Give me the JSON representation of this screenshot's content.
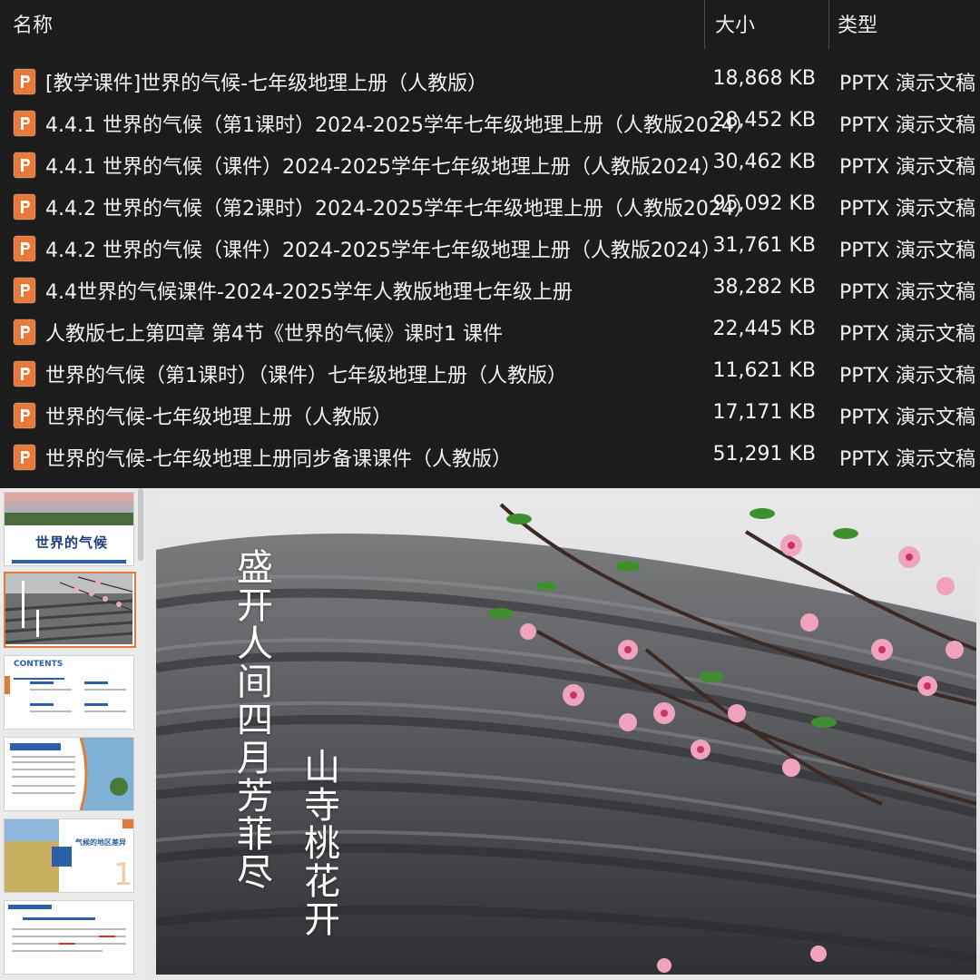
{
  "explorer": {
    "columns": {
      "name": "名称",
      "size": "大小",
      "type": "类型"
    },
    "files": [
      {
        "name": "[教学课件]世界的气候-七年级地理上册（人教版）",
        "size": "18,868 KB",
        "type": "PPTX 演示文稿"
      },
      {
        "name": "4.4.1 世界的气候（第1课时）2024-2025学年七年级地理上册（人教版2024）",
        "size": "28,452 KB",
        "type": "PPTX 演示文稿"
      },
      {
        "name": "4.4.1 世界的气候（课件）2024-2025学年七年级地理上册（人教版2024）",
        "size": "30,462 KB",
        "type": "PPTX 演示文稿"
      },
      {
        "name": "4.4.2 世界的气候（第2课时）2024-2025学年七年级地理上册（人教版2024）",
        "size": "95,092 KB",
        "type": "PPTX 演示文稿"
      },
      {
        "name": "4.4.2 世界的气候（课件）2024-2025学年七年级地理上册（人教版2024）",
        "size": "31,761 KB",
        "type": "PPTX 演示文稿"
      },
      {
        "name": "4.4世界的气候课件-2024-2025学年人教版地理七年级上册",
        "size": "38,282 KB",
        "type": "PPTX 演示文稿"
      },
      {
        "name": "人教版七上第四章 第4节《世界的气候》课时1 课件",
        "size": "22,445 KB",
        "type": "PPTX 演示文稿"
      },
      {
        "name": "世界的气候（第1课时）（课件）七年级地理上册（人教版）",
        "size": "11,621 KB",
        "type": "PPTX 演示文稿"
      },
      {
        "name": "世界的气候-七年级地理上册（人教版）",
        "size": "17,171 KB",
        "type": "PPTX 演示文稿"
      },
      {
        "name": "世界的气候-七年级地理上册同步备课课件（人教版）",
        "size": "51,291 KB",
        "type": "PPTX 演示文稿"
      }
    ]
  },
  "thumbnails": {
    "t1_title": "世界的气候",
    "t3_title": "CONTENTS",
    "t5_title": "气候的地区差异"
  },
  "slide": {
    "poem_line1": "盛开人间四月芳菲尽",
    "poem_line2": "山寺桃花开"
  },
  "colors": {
    "accent": "#e07b3a",
    "ppt_icon": "#e8793a",
    "background": "#1c1c1c"
  }
}
